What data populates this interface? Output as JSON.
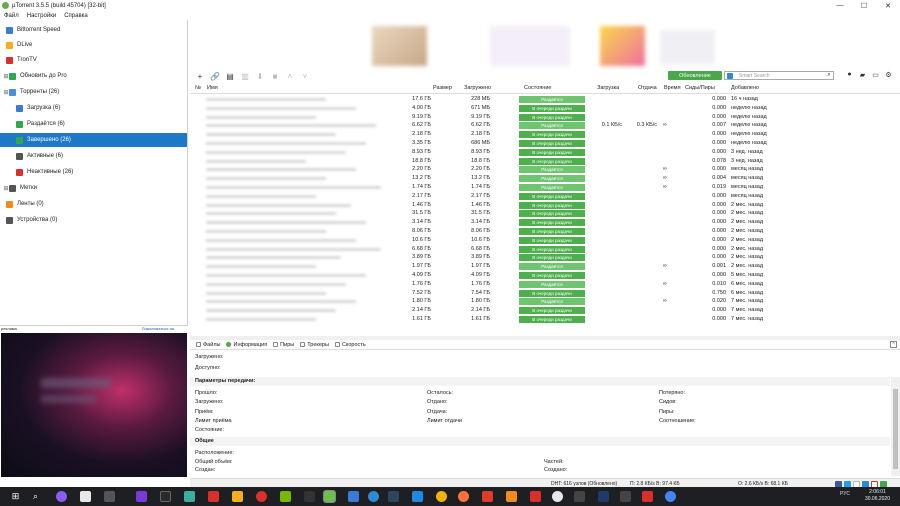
{
  "window": {
    "title": "µTorrent 3.5.5  (build 45704) [32-bit]",
    "minimize": "—",
    "maximize": "☐",
    "close": "✕"
  },
  "menu": [
    "Файл",
    "Настройки",
    "Справка"
  ],
  "sidebar": {
    "items": [
      {
        "label": "Bittorrent Speed",
        "icon": "speed-icon",
        "color": "#3a7bd5"
      },
      {
        "label": "DLive",
        "icon": "dlive-icon",
        "color": "#f2b01e"
      },
      {
        "label": "TronTV",
        "icon": "trontv-icon",
        "color": "#d9302c"
      },
      {
        "label": "Обновить до Pro",
        "icon": "pro-icon",
        "color": "#2ea84a"
      },
      {
        "label": "Торренты (26)",
        "icon": "torrents-icon",
        "color": "#4a90d9"
      },
      {
        "label": "Загрузка (6)",
        "icon": "download-icon",
        "color": "#3a7bd5"
      },
      {
        "label": "Раздаётся (6)",
        "icon": "upload-icon",
        "color": "#2ea84a"
      },
      {
        "label": "Завершено (26)",
        "icon": "completed-icon",
        "color": "#2ea84a"
      },
      {
        "label": "Активные (6)",
        "icon": "active-icon",
        "color": "#555555"
      },
      {
        "label": "Неактивные (26)",
        "icon": "inactive-icon",
        "color": "#d9302c"
      },
      {
        "label": "Метки",
        "icon": "labels-icon",
        "color": "#555555"
      },
      {
        "label": "Ленты (0)",
        "icon": "feeds-icon",
        "color": "#f28b1e"
      },
      {
        "label": "Устройства (0)",
        "icon": "devices-icon",
        "color": "#555555"
      }
    ],
    "selected_index": 7
  },
  "ad": {
    "left_label": "реклама",
    "right_label": "Пожаловаться на"
  },
  "toolbar": {
    "update_button": "Обновление",
    "search_placeholder": "Smart Search"
  },
  "table": {
    "columns": [
      "№",
      "Имя",
      "Размер",
      "Загружено",
      "Состояние",
      "Загрузка",
      "Отдача",
      "Время",
      "Сиды/Пиры",
      "Добавлено"
    ],
    "rows": [
      {
        "size": "17.6 ГБ",
        "done": "228 МБ",
        "status": "Раздаётся",
        "kind": "seed",
        "down": "",
        "up": "",
        "eta": "",
        "ratio": "0.000",
        "added": "16 ч назад"
      },
      {
        "size": "4.00 ГБ",
        "done": "671 МБ",
        "status": "В очереди раздачи",
        "kind": "queue",
        "down": "",
        "up": "",
        "eta": "",
        "ratio": "0.000",
        "added": "неделю назад"
      },
      {
        "size": "9.19 ГБ",
        "done": "9.19 ГБ",
        "status": "В очереди раздачи",
        "kind": "queue",
        "down": "",
        "up": "",
        "eta": "",
        "ratio": "0.000",
        "added": "неделю назад"
      },
      {
        "size": "6.62 ГБ",
        "done": "6.62 ГБ",
        "status": "Раздаётся",
        "kind": "seed",
        "down": "0.1 КБ/с",
        "up": "0.3 КБ/с",
        "eta": "∞",
        "ratio": "0.007",
        "added": "неделю назад"
      },
      {
        "size": "2.18 ГБ",
        "done": "2.18 ГБ",
        "status": "В очереди раздачи",
        "kind": "queue",
        "down": "",
        "up": "",
        "eta": "",
        "ratio": "0.000",
        "added": "неделю назад"
      },
      {
        "size": "3.35 ГБ",
        "done": "686 МБ",
        "status": "В очереди раздачи",
        "kind": "queue",
        "down": "",
        "up": "",
        "eta": "",
        "ratio": "0.000",
        "added": "неделю назад"
      },
      {
        "size": "8.93 ГБ",
        "done": "8.93 ГБ",
        "status": "В очереди раздачи",
        "kind": "queue",
        "down": "",
        "up": "",
        "eta": "",
        "ratio": "0.000",
        "added": "3 нед. назад"
      },
      {
        "size": "18.8 ГБ",
        "done": "18.8 ГБ",
        "status": "В очереди раздачи",
        "kind": "queue",
        "down": "",
        "up": "",
        "eta": "",
        "ratio": "0.078",
        "added": "3 нед. назад"
      },
      {
        "size": "2.20 ГБ",
        "done": "2.20 ГБ",
        "status": "Раздаётся",
        "kind": "seed",
        "down": "",
        "up": "",
        "eta": "∞",
        "ratio": "0.000",
        "added": "месяц назад"
      },
      {
        "size": "13.2 ГБ",
        "done": "13.2 ГБ",
        "status": "Раздаётся",
        "kind": "seed",
        "down": "",
        "up": "",
        "eta": "∞",
        "ratio": "0.004",
        "added": "месяц назад"
      },
      {
        "size": "1.74 ГБ",
        "done": "1.74 ГБ",
        "status": "Раздаётся",
        "kind": "seed",
        "down": "",
        "up": "",
        "eta": "∞",
        "ratio": "0.019",
        "added": "месяц назад"
      },
      {
        "size": "2.17 ГБ",
        "done": "2.17 ГБ",
        "status": "В очереди раздачи",
        "kind": "queue",
        "down": "",
        "up": "",
        "eta": "",
        "ratio": "0.000",
        "added": "месяц назад"
      },
      {
        "size": "1.46 ГБ",
        "done": "1.46 ГБ",
        "status": "В очереди раздачи",
        "kind": "queue",
        "down": "",
        "up": "",
        "eta": "",
        "ratio": "0.000",
        "added": "2 мес. назад"
      },
      {
        "size": "31.5 ГБ",
        "done": "31.5 ГБ",
        "status": "В очереди раздачи",
        "kind": "queue",
        "down": "",
        "up": "",
        "eta": "",
        "ratio": "0.000",
        "added": "2 мес. назад"
      },
      {
        "size": "3.14 ГБ",
        "done": "3.14 ГБ",
        "status": "В очереди раздачи",
        "kind": "queue",
        "down": "",
        "up": "",
        "eta": "",
        "ratio": "0.000",
        "added": "2 мес. назад"
      },
      {
        "size": "8.06 ГБ",
        "done": "8.06 ГБ",
        "status": "В очереди раздачи",
        "kind": "queue",
        "down": "",
        "up": "",
        "eta": "",
        "ratio": "0.000",
        "added": "2 мес. назад"
      },
      {
        "size": "10.6 ГБ",
        "done": "10.6 ГБ",
        "status": "В очереди раздачи",
        "kind": "queue",
        "down": "",
        "up": "",
        "eta": "",
        "ratio": "0.000",
        "added": "2 мес. назад"
      },
      {
        "size": "6.68 ГБ",
        "done": "6.68 ГБ",
        "status": "В очереди раздачи",
        "kind": "queue",
        "down": "",
        "up": "",
        "eta": "",
        "ratio": "0.000",
        "added": "2 мес. назад"
      },
      {
        "size": "3.89 ГБ",
        "done": "3.89 ГБ",
        "status": "В очереди раздачи",
        "kind": "queue",
        "down": "",
        "up": "",
        "eta": "",
        "ratio": "0.000",
        "added": "2 мес. назад"
      },
      {
        "size": "1.97 ГБ",
        "done": "1.97 ГБ",
        "status": "Раздаётся",
        "kind": "seed",
        "down": "",
        "up": "",
        "eta": "∞",
        "ratio": "0.001",
        "added": "2 мес. назад"
      },
      {
        "size": "4.09 ГБ",
        "done": "4.09 ГБ",
        "status": "В очереди раздачи",
        "kind": "queue",
        "down": "",
        "up": "",
        "eta": "",
        "ratio": "0.000",
        "added": "5 мес. назад"
      },
      {
        "size": "1.76 ГБ",
        "done": "1.76 ГБ",
        "status": "Раздаётся",
        "kind": "seed",
        "down": "",
        "up": "",
        "eta": "∞",
        "ratio": "0.010",
        "added": "6 мес. назад"
      },
      {
        "size": "7.52 ГБ",
        "done": "7.54 ГБ",
        "status": "В очереди раздачи",
        "kind": "queue",
        "down": "",
        "up": "",
        "eta": "",
        "ratio": "0.750",
        "added": "6 мес. назад"
      },
      {
        "size": "1.80 ГБ",
        "done": "1.80 ГБ",
        "status": "Раздаётся",
        "kind": "seed",
        "down": "",
        "up": "",
        "eta": "∞",
        "ratio": "0.020",
        "added": "7 мес. назад"
      },
      {
        "size": "2.14 ГБ",
        "done": "2.14 ГБ",
        "status": "В очереди раздачи",
        "kind": "queue",
        "down": "",
        "up": "",
        "eta": "",
        "ratio": "0.000",
        "added": "7 мес. назад"
      },
      {
        "size": "1.61 ГБ",
        "done": "1.61 ГБ",
        "status": "В очереди раздачи",
        "kind": "queue",
        "down": "",
        "up": "",
        "eta": "",
        "ratio": "0.000",
        "added": "7 мес. назад"
      }
    ]
  },
  "detail_tabs": [
    "Файлы",
    "Информация",
    "Пиры",
    "Трекеры",
    "Скорость"
  ],
  "detail_active_tab": "Информация",
  "details": {
    "downloaded": "Загружено:",
    "available": "Доступно:",
    "transfer_header": "Параметры передачи:",
    "col1": [
      "Прошло:",
      "Загружено:",
      "Приём:",
      "Лимит приёма",
      "Состояние:"
    ],
    "col2": [
      "Осталось:",
      "Отдано:",
      "Отдача:",
      "Лимит отдачи"
    ],
    "col3": [
      "Потеряно:",
      "Сидов:",
      "Пиры:",
      "Соотношение:"
    ],
    "general_header": "Общие",
    "gen1": [
      "Расположение:",
      "Общий объём:",
      "Создан:"
    ],
    "gen2": [
      "Частей:",
      "Создано:"
    ]
  },
  "statusbar": {
    "dht": "DHT: 616 узлов  (Обновлено)",
    "down": "П: 2.8 КБ/s  В: 97.4 КБ",
    "up": "О: 2.6 КБ/s  В: 68.1 КБ"
  },
  "taskbar": {
    "lang": "РУС",
    "time": "2:06:01",
    "date": "30.06.2020"
  }
}
